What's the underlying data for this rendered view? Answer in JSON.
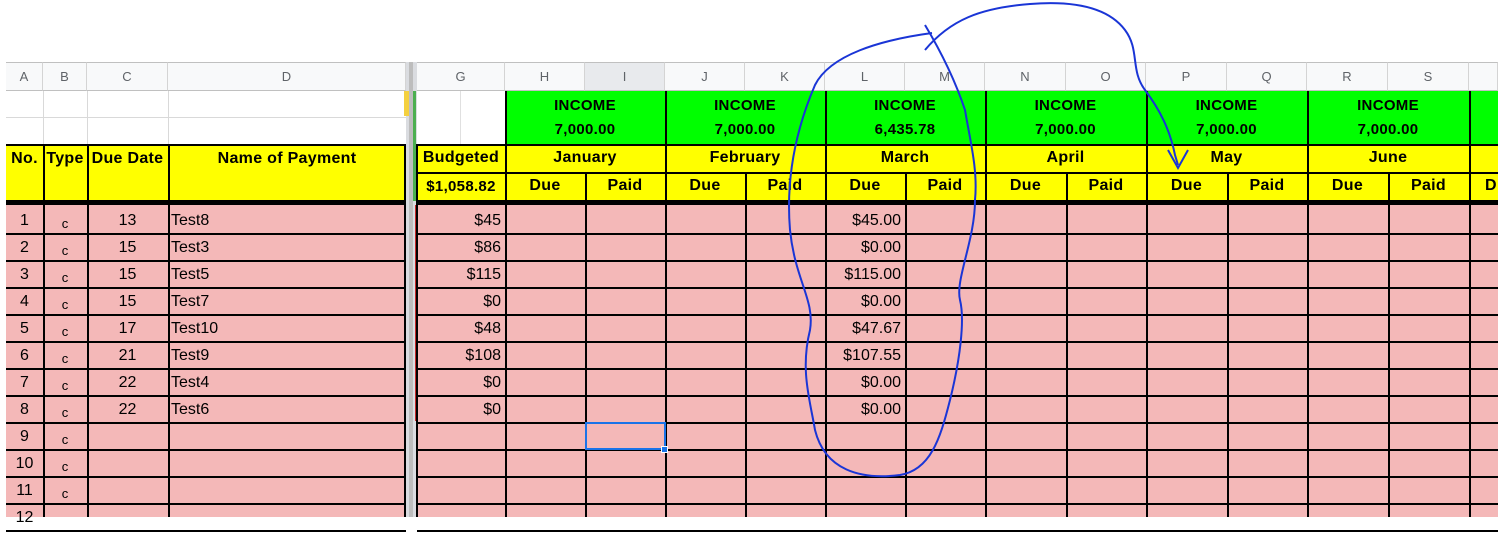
{
  "columns_left": [
    "A",
    "B",
    "C",
    "D"
  ],
  "columns_right": [
    "G",
    "H",
    "I",
    "J",
    "K",
    "L",
    "M",
    "N",
    "O",
    "P",
    "Q",
    "R",
    "S"
  ],
  "header": {
    "no": "No.",
    "type": "Type",
    "due_date": "Due Date",
    "name": "Name of Payment",
    "budgeted": "Budgeted",
    "budgeted_total": "$1,058.82"
  },
  "months": [
    {
      "income_label": "INCOME",
      "income": "7,000.00",
      "name": "January",
      "due": "Due",
      "paid": "Paid"
    },
    {
      "income_label": "INCOME",
      "income": "7,000.00",
      "name": "February",
      "due": "Due",
      "paid": "Paid"
    },
    {
      "income_label": "INCOME",
      "income": "6,435.78",
      "name": "March",
      "due": "Due",
      "paid": "Paid"
    },
    {
      "income_label": "INCOME",
      "income": "7,000.00",
      "name": "April",
      "due": "Due",
      "paid": "Paid"
    },
    {
      "income_label": "INCOME",
      "income": "7,000.00",
      "name": "May",
      "due": "Due",
      "paid": "Paid"
    },
    {
      "income_label": "INCOME",
      "income": "7,000.00",
      "name": "June",
      "due": "Due",
      "paid": "Paid"
    }
  ],
  "rows": [
    {
      "no": "1",
      "type": "c",
      "due": "13",
      "name": "Test8",
      "budgeted": "$45",
      "march_due": "$45.00"
    },
    {
      "no": "2",
      "type": "c",
      "due": "15",
      "name": "Test3",
      "budgeted": "$86",
      "march_due": "$0.00"
    },
    {
      "no": "3",
      "type": "c",
      "due": "15",
      "name": "Test5",
      "budgeted": "$115",
      "march_due": "$115.00"
    },
    {
      "no": "4",
      "type": "c",
      "due": "15",
      "name": "Test7",
      "budgeted": "$0",
      "march_due": "$0.00"
    },
    {
      "no": "5",
      "type": "c",
      "due": "17",
      "name": "Test10",
      "budgeted": "$48",
      "march_due": "$47.67"
    },
    {
      "no": "6",
      "type": "c",
      "due": "21",
      "name": "Test9",
      "budgeted": "$108",
      "march_due": "$107.55"
    },
    {
      "no": "7",
      "type": "c",
      "due": "22",
      "name": "Test4",
      "budgeted": "$0",
      "march_due": "$0.00"
    },
    {
      "no": "8",
      "type": "c",
      "due": "22",
      "name": "Test6",
      "budgeted": "$0",
      "march_due": "$0.00"
    },
    {
      "no": "9",
      "type": "c",
      "due": "",
      "name": "",
      "budgeted": "",
      "march_due": ""
    },
    {
      "no": "10",
      "type": "c",
      "due": "",
      "name": "",
      "budgeted": "",
      "march_due": ""
    },
    {
      "no": "11",
      "type": "c",
      "due": "",
      "name": "",
      "budgeted": "",
      "march_due": ""
    },
    {
      "no": "12",
      "type": "",
      "due": "",
      "name": "",
      "budgeted": "",
      "march_due": ""
    }
  ],
  "selected_cell": "I9",
  "colors": {
    "income_green": "#00ff00",
    "header_yellow": "#ffff00",
    "row_pink": "#f4b8b8",
    "annotation_blue": "#1a35d6",
    "selection_blue": "#1a73e8"
  }
}
